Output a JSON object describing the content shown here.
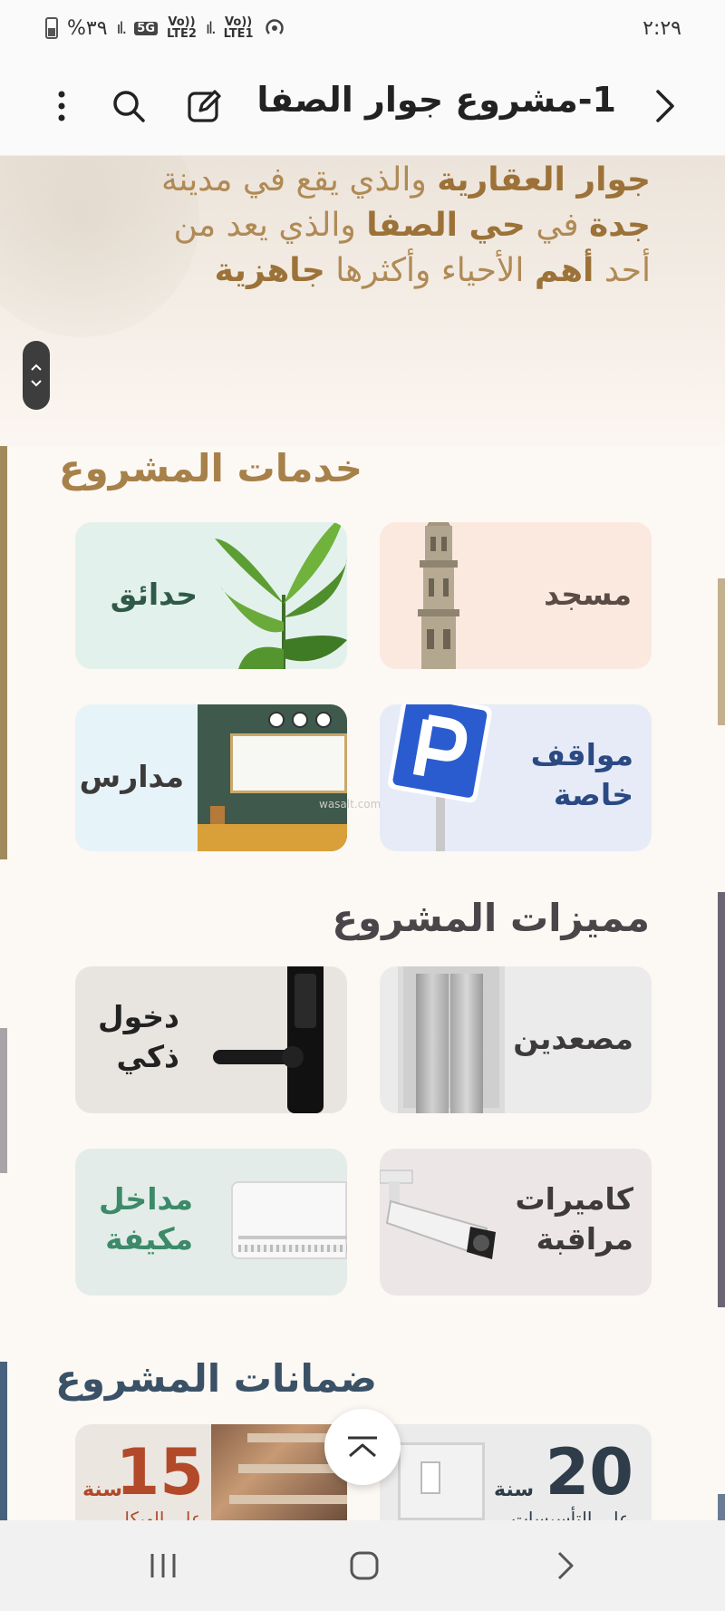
{
  "status_bar": {
    "time": "٢:٢٩",
    "battery": "%٣٩",
    "network_5g": "5G",
    "lte2": "LTE2",
    "lte1": "LTE1",
    "volte": "Vo))"
  },
  "header": {
    "title": "1-مشروع جوار الصفا"
  },
  "hero": {
    "line1_bold": "جوار العقارية",
    "line1_rest": " والذي يقع في مدينة",
    "line2_bold1": "جدة",
    "line2_mid": " في ",
    "line2_bold2": "حي الصفا",
    "line2_rest": " والذي يعد من",
    "line3_start": "أحد ",
    "line3_bold1": "أهم",
    "line3_mid": " الأحياء وأكثرها ",
    "line3_bold2": "جاهزية"
  },
  "services": {
    "title": "خدمات المشروع",
    "items": [
      {
        "label": "مسجد"
      },
      {
        "label": "حدائق"
      },
      {
        "label": "مواقف\nخاصة"
      },
      {
        "label": "مدارس"
      }
    ],
    "watermark": "wasalt.com"
  },
  "features": {
    "title": "مميزات المشروع",
    "items": [
      {
        "label": "مصعدين"
      },
      {
        "label": "دخول\nذكي"
      },
      {
        "label": "كاميرات\nمراقبة"
      },
      {
        "label": "مداخل\nمكيفة"
      }
    ]
  },
  "guarantees": {
    "title": "ضمانات المشروع",
    "items": [
      {
        "number": "20",
        "unit": "سنة",
        "caption": "على التأسيسات"
      },
      {
        "number": "15",
        "unit": "سنة",
        "caption": "على الهيكل"
      }
    ]
  },
  "colors": {
    "gold": "#a7814a",
    "green_text": "#2f5a48",
    "blue_text": "#2b4a82",
    "dark_text": "#3d3a3a"
  }
}
